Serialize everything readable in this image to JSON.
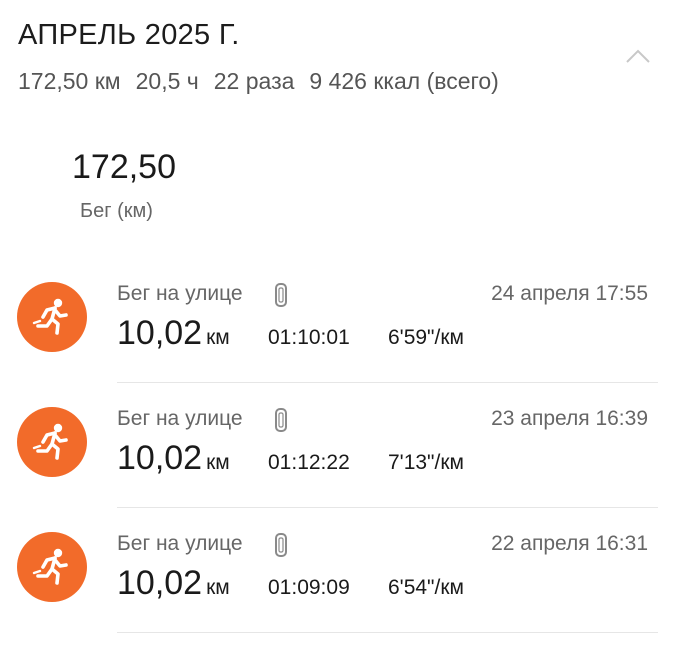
{
  "header": {
    "month_title": "АПРЕЛЬ 2025 Г.",
    "collapse_icon": "chevron-up-icon"
  },
  "summary": {
    "distance": "172,50 км",
    "duration": "20,5 ч",
    "count": "22 раза",
    "calories": "9 426 ккал (всего)"
  },
  "total": {
    "value": "172,50",
    "label": "Бег (км)"
  },
  "colors": {
    "accent": "#f26b2a",
    "divider": "#e6e6e6"
  },
  "workouts": [
    {
      "icon": "running-person-icon",
      "type": "Бег на улице",
      "device_icon": "watch-icon",
      "datetime": "24 апреля 17:55",
      "distance": "10,02",
      "unit": "км",
      "duration": "01:10:01",
      "pace": "6'59\"/км"
    },
    {
      "icon": "running-person-icon",
      "type": "Бег на улице",
      "device_icon": "watch-icon",
      "datetime": "23 апреля 16:39",
      "distance": "10,02",
      "unit": "км",
      "duration": "01:12:22",
      "pace": "7'13\"/км"
    },
    {
      "icon": "running-person-icon",
      "type": "Бег на улице",
      "device_icon": "watch-icon",
      "datetime": "22 апреля 16:31",
      "distance": "10,02",
      "unit": "км",
      "duration": "01:09:09",
      "pace": "6'54\"/км"
    }
  ]
}
